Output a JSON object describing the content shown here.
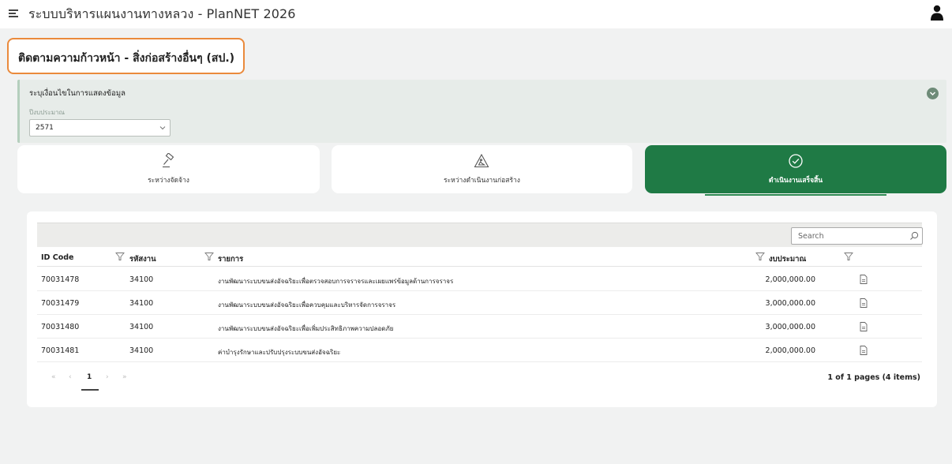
{
  "header": {
    "app_title": "ระบบบริหารแผนงานทางหลวง - PlanNET 2026"
  },
  "page": {
    "title": "ติดตามความก้าวหน้า - สิ่งก่อสร้างอื่นๆ (สป.)"
  },
  "filter": {
    "heading": "ระบุเงื่อนไขในการแสดงข้อมูล",
    "year_label": "ปีงบประมาณ",
    "year_value": "2571"
  },
  "status_tabs": [
    {
      "label": "ระหว่างจัดจ้าง",
      "icon": "gavel-icon",
      "active": false
    },
    {
      "label": "ระหว่างดำเนินงานก่อสร้าง",
      "icon": "construction-warning-icon",
      "active": false
    },
    {
      "label": "ดำเนินงานเสร็จสิ้น",
      "icon": "check-circle-icon",
      "active": true
    }
  ],
  "colors": {
    "accent_green": "#1f7a45",
    "title_border_orange": "#ea8a3c"
  },
  "table": {
    "search_placeholder": "Search",
    "columns": {
      "id_code": "ID Code",
      "project_code": "รหัสงาน",
      "item": "รายการ",
      "budget": "งบประมาณ"
    },
    "rows": [
      {
        "id_code": "70031478",
        "project_code": "34100",
        "item": "งานพัฒนาระบบขนส่งอัจฉริยะเพื่อตรวจสอบการจราจรและเผยแพร่ข้อมูลด้านการจราจร",
        "budget": "2,000,000.00"
      },
      {
        "id_code": "70031479",
        "project_code": "34100",
        "item": "งานพัฒนาระบบขนส่งอัจฉริยะเพื่อควบคุมและบริหารจัดการจราจร",
        "budget": "3,000,000.00"
      },
      {
        "id_code": "70031480",
        "project_code": "34100",
        "item": "งานพัฒนาระบบขนส่งอัจฉริยะเพื่อเพิ่มประสิทธิภาพความปลอดภัย",
        "budget": "3,000,000.00"
      },
      {
        "id_code": "70031481",
        "project_code": "34100",
        "item": "ค่าบำรุงรักษาและปรับปรุงระบบขนส่งอัจฉริยะ",
        "budget": "2,000,000.00"
      }
    ],
    "pager": {
      "first": "«",
      "prev": "‹",
      "current_page": "1",
      "next": "›",
      "last": "»",
      "summary": "1 of 1 pages (4 items)"
    }
  }
}
